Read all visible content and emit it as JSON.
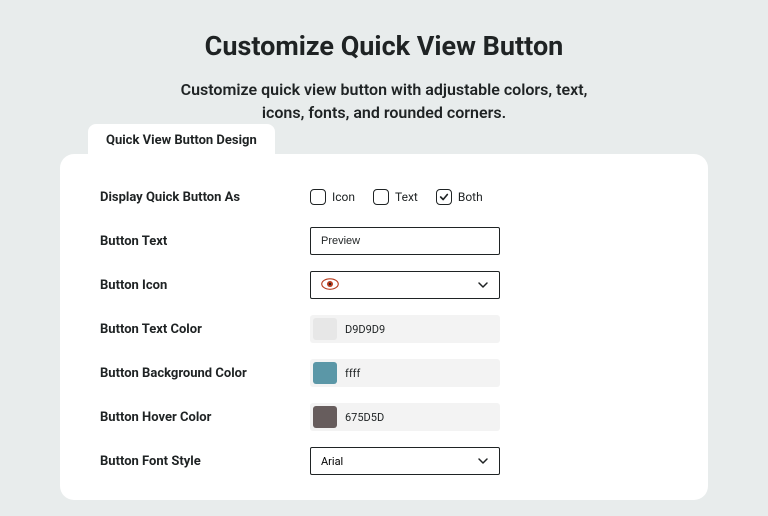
{
  "title": "Customize Quick View Button",
  "subtitle": "Customize quick view button with adjustable colors, text, icons, fonts, and rounded corners.",
  "tab": {
    "label": "Quick View Button Design"
  },
  "form": {
    "display_as": {
      "label": "Display Quick Button As",
      "options": [
        {
          "label": "Icon",
          "checked": false
        },
        {
          "label": "Text",
          "checked": false
        },
        {
          "label": "Both",
          "checked": true
        }
      ]
    },
    "button_text": {
      "label": "Button Text",
      "value": "Preview"
    },
    "button_icon": {
      "label": "Button Icon",
      "value": "eye"
    },
    "text_color": {
      "label": "Button Text Color",
      "value": "D9D9D9",
      "swatch": "#e7e7e7"
    },
    "bg_color": {
      "label": "Button Background Color",
      "value": "ffff",
      "swatch": "#5b97a7"
    },
    "hover_color": {
      "label": "Button Hover Color",
      "value": "675D5D",
      "swatch": "#675d5d"
    },
    "font_style": {
      "label": "Button Font Style",
      "value": "Arial"
    }
  }
}
